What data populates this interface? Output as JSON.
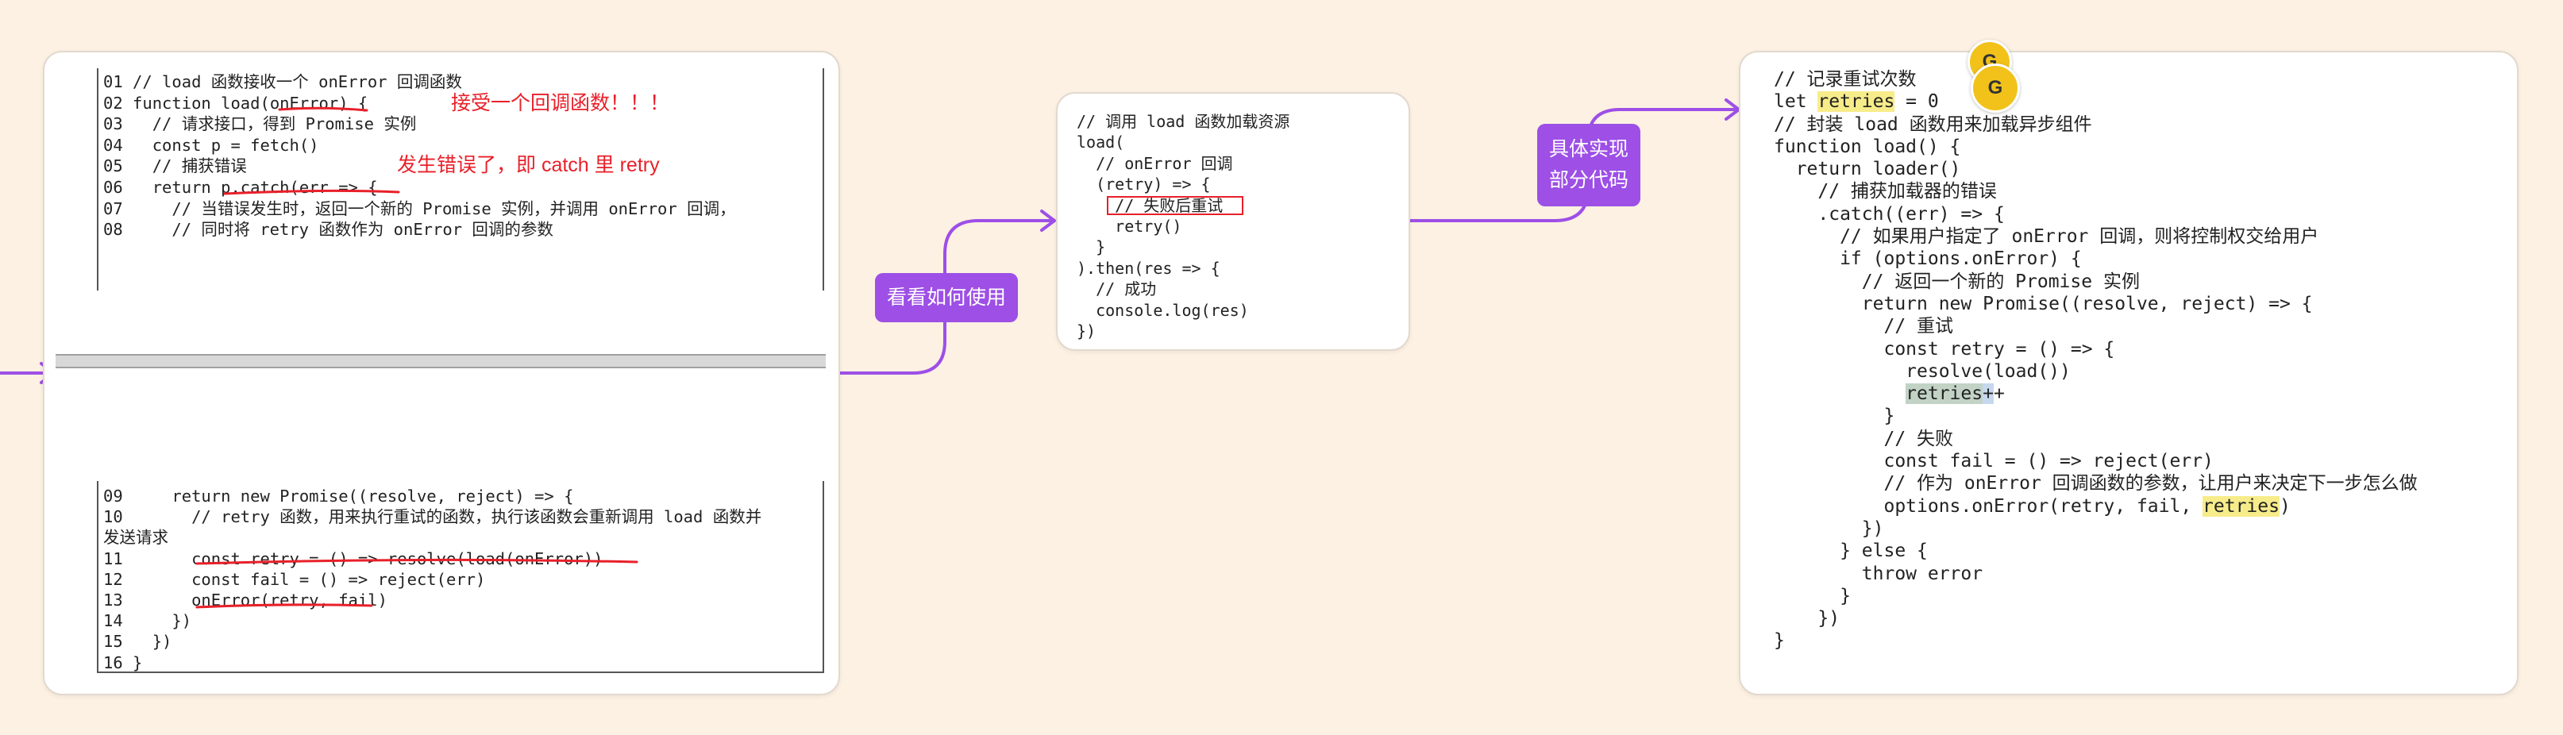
{
  "colors": {
    "background": "#fdf1e3",
    "connector": "#9d4fe6",
    "annotation": "#e8202a",
    "highlight": "#f7ec8a"
  },
  "card1": {
    "top_lines": [
      "01 // load 函数接收一个 onError 回调函数",
      "02 function load(onError) {",
      "03   // 请求接口，得到 Promise 实例",
      "04   const p = fetch()",
      "05   // 捕获错误",
      "06   return p.catch(err => {",
      "07     // 当错误发生时，返回一个新的 Promise 实例，并调用 onError 回调，",
      "08     // 同时将 retry 函数作为 onError 回调的参数"
    ],
    "bottom_lines": [
      "09     return new Promise((resolve, reject) => {",
      "10       // retry 函数，用来执行重试的函数，执行该函数会重新调用 load 函数并",
      "发送请求",
      "11       const retry = () => resolve(load(onError))",
      "12       const fail = () => reject(err)",
      "13       onError(retry, fail)",
      "14     })",
      "15   })",
      "16 }"
    ],
    "annotation_1": "接受一个回调函数！！！",
    "annotation_2": "发生错误了，即 catch 里 retry"
  },
  "tags": {
    "how_to_use": "看看如何使用",
    "impl_line1": "具体实现",
    "impl_line2": "部分代码"
  },
  "card2": {
    "lines": [
      "// 调用 load 函数加载资源",
      "load(",
      "  // onError 回调",
      "  (retry) => {",
      "    // 失败后重试",
      "    retry()",
      "  }",
      ").then(res => {",
      "  // 成功",
      "  console.log(res)",
      "})"
    ]
  },
  "card3": {
    "line1_comment": "// 记录重试次数",
    "line2_let": "let ",
    "line2_var": "retries",
    "line2_rest": " = 0",
    "lines_a": [
      "// 封装 load 函数用来加载异步组件",
      "function load() {",
      "  return loader()",
      "    // 捕获加载器的错误",
      "    .catch((err) => {",
      "      // 如果用户指定了 onError 回调，则将控制权交给用户",
      "      if (options.onError) {",
      "        // 返回一个新的 Promise 实例",
      "        return new Promise((resolve, reject) => {",
      "          // 重试",
      "          const retry = () => {",
      "            resolve(load())"
    ],
    "inc_indent": "            ",
    "inc_var": "retries",
    "inc_op1": "+",
    "inc_op2": "+",
    "lines_b": [
      "          }",
      "          // 失败",
      "          const fail = () => reject(err)",
      "          // 作为 onError 回调函数的参数，让用户来决定下一步怎么做"
    ],
    "call_prefix": "          options.onError(retry, fail, ",
    "call_var": "retries",
    "call_suffix": ")",
    "lines_c": [
      "        })",
      "      } else {",
      "        throw error",
      "      }",
      "    })",
      "}"
    ]
  },
  "avatars": [
    "G",
    "G"
  ]
}
